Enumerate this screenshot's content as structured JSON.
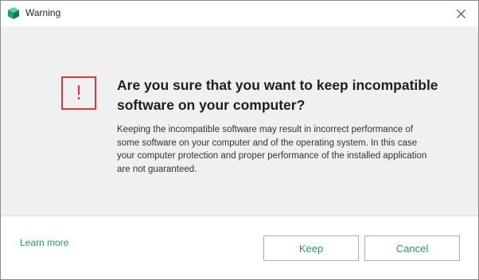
{
  "window": {
    "title": "Warning",
    "app_icon": "kaspersky-cube-icon",
    "close_icon": "close-icon"
  },
  "dialog": {
    "warning_icon": "exclamation-warning-icon",
    "warning_symbol": "!",
    "heading": "Are you sure that you want to keep incompatible software on your computer?",
    "body": "Keeping the incompatible software may result in incorrect performance of some software on your computer and of the operating system. In this case your computer protection and proper performance of the installed application are not guaranteed."
  },
  "footer": {
    "learn_more": "Learn more",
    "keep_label": "Keep",
    "cancel_label": "Cancel"
  },
  "colors": {
    "accent": "#2d8f7b",
    "warning": "#d9383c",
    "content_bg": "#f0f0f0"
  }
}
